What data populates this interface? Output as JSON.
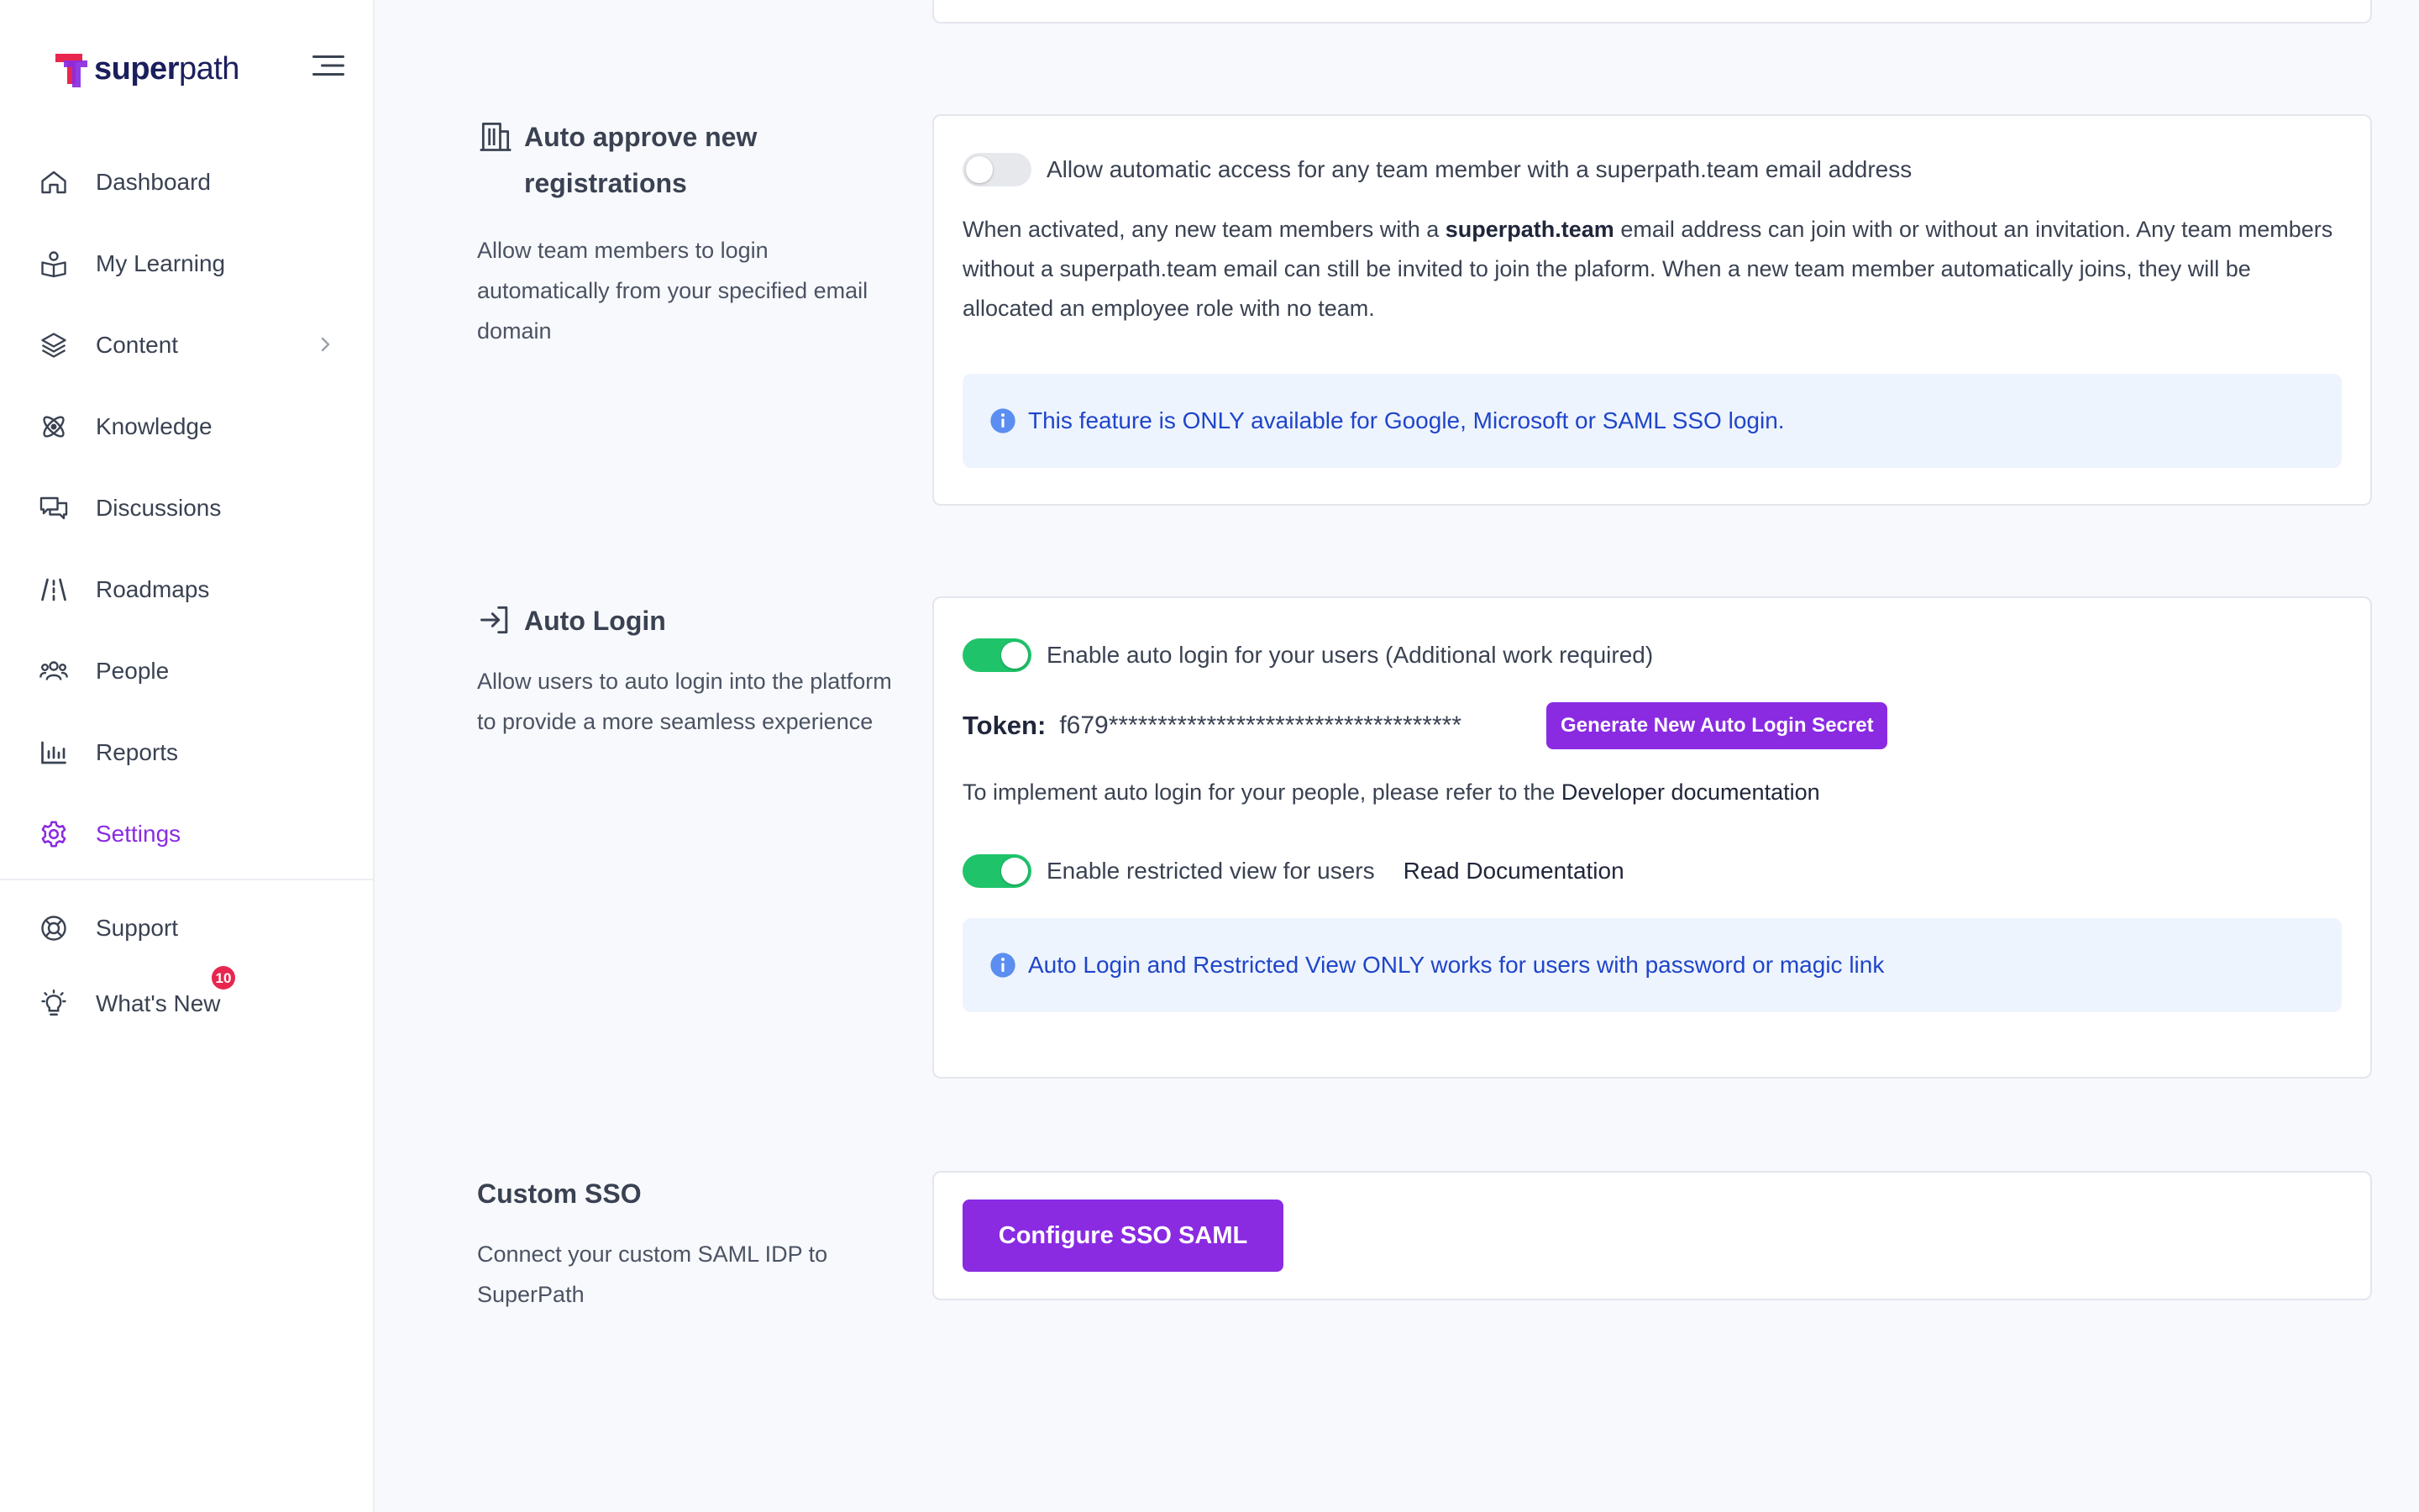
{
  "brand": {
    "name_bold": "super",
    "name_rest": "path"
  },
  "sidebar": {
    "items": [
      {
        "label": "Dashboard",
        "icon": "home-icon"
      },
      {
        "label": "My Learning",
        "icon": "learning-icon"
      },
      {
        "label": "Content",
        "icon": "layers-icon"
      },
      {
        "label": "Knowledge",
        "icon": "atom-icon"
      },
      {
        "label": "Discussions",
        "icon": "chat-bubbles-icon"
      },
      {
        "label": "Roadmaps",
        "icon": "road-icon"
      },
      {
        "label": "People",
        "icon": "people-icon"
      },
      {
        "label": "Reports",
        "icon": "bar-chart-icon"
      },
      {
        "label": "Settings",
        "icon": "gear-icon"
      }
    ],
    "secondary": [
      {
        "label": "Support",
        "icon": "lifebuoy-icon"
      },
      {
        "label": "What's New",
        "icon": "lightbulb-icon",
        "badge": "10"
      }
    ],
    "active": "Settings"
  },
  "auto_approve": {
    "title_line1": "Auto approve new",
    "title_line2": "registrations",
    "description": "Allow team members to login automatically from your specified email domain",
    "toggle_label": "Allow automatic access for any team member with a superpath.team email address",
    "toggle_on": false,
    "para_pre": "When activated, any new team members with a ",
    "para_bold": "superpath.team",
    "para_post": " email address can join with or without an invitation. Any team members without a superpath.team email can still be invited to join the plaform. When a new team member automatically joins, they will be allocated an employee role with no team.",
    "info": "This feature is ONLY available for Google, Microsoft or SAML SSO login."
  },
  "auto_login": {
    "title": "Auto Login",
    "description": "Allow users to auto login into the platform to provide a more seamless experience",
    "toggle_label": "Enable auto login for your users (Additional work required)",
    "toggle_on": true,
    "token_label": "Token:",
    "token_value": "f679************************************",
    "generate_button": "Generate New Auto Login Secret",
    "implement_text": "To implement auto login for your people, please refer to the ",
    "developer_link": "Developer documentation",
    "restricted_label": "Enable restricted view for users",
    "restricted_on": true,
    "read_docs": "Read Documentation",
    "info": "Auto Login and Restricted View ONLY works for users with password or magic link"
  },
  "custom_sso": {
    "title": "Custom SSO",
    "description": "Connect your custom SAML IDP to SuperPath",
    "button": "Configure SSO SAML"
  },
  "colors": {
    "accent": "#8a2be2",
    "toggle_on": "#1fc46a",
    "info_bg": "#eef4fd",
    "info_text": "#1f45c9",
    "badge": "#e8264f"
  }
}
